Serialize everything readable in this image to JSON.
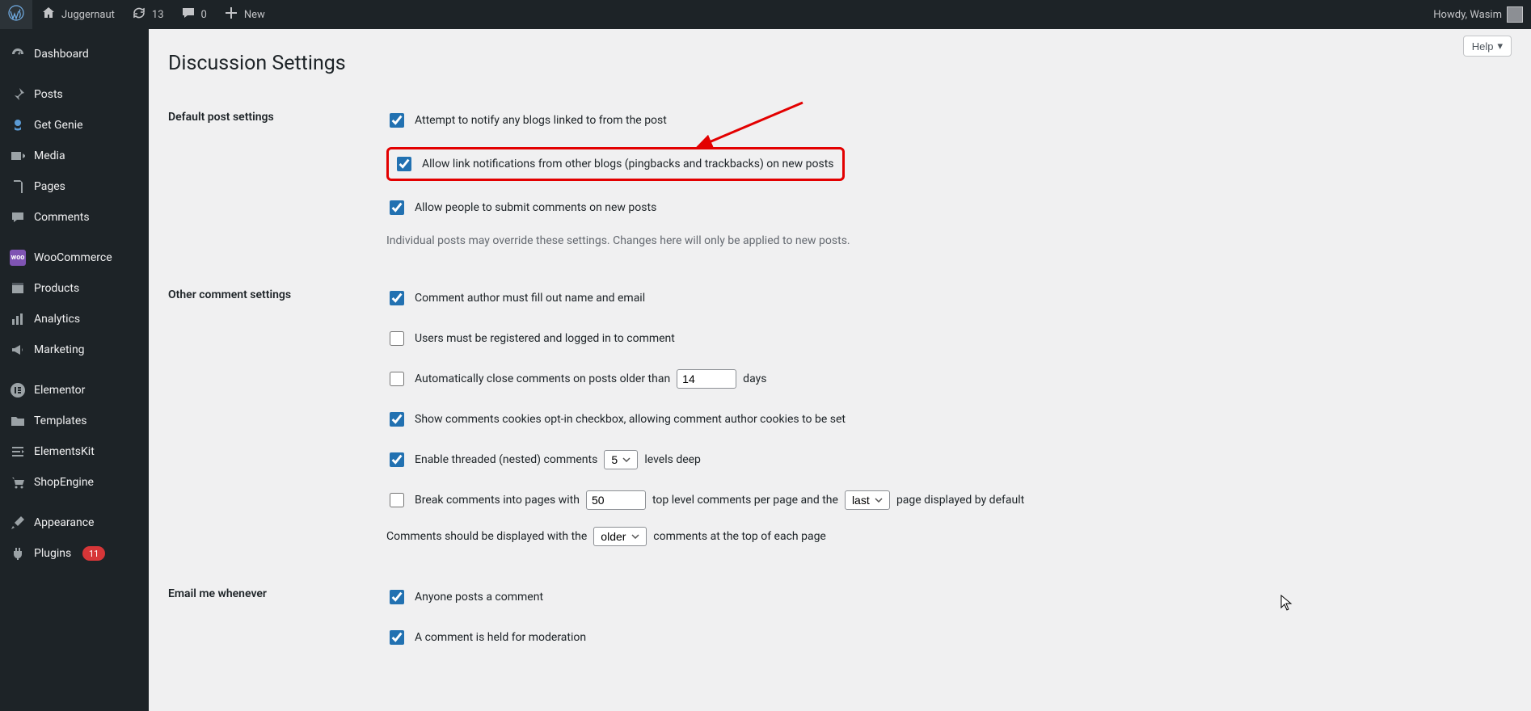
{
  "adminbar": {
    "site_name": "Juggernaut",
    "updates_count": "13",
    "comments_count": "0",
    "new_label": "New",
    "howdy": "Howdy, Wasim"
  },
  "menu": {
    "dashboard": "Dashboard",
    "posts": "Posts",
    "getgenie": "Get Genie",
    "media": "Media",
    "pages": "Pages",
    "comments": "Comments",
    "woocommerce": "WooCommerce",
    "products": "Products",
    "analytics": "Analytics",
    "marketing": "Marketing",
    "elementor": "Elementor",
    "templates": "Templates",
    "elementskit": "ElementsKit",
    "shopengine": "ShopEngine",
    "appearance": "Appearance",
    "plugins": "Plugins",
    "plugins_badge": "11"
  },
  "help_label": "Help",
  "page_title": "Discussion Settings",
  "rows": {
    "default_post": "Default post settings",
    "other_comment": "Other comment settings",
    "email_me": "Email me whenever"
  },
  "opts": {
    "pingback_out": "Attempt to notify any blogs linked to from the post",
    "pingback_in": "Allow link notifications from other blogs (pingbacks and trackbacks) on new posts",
    "allow_comments": "Allow people to submit comments on new posts",
    "override_note": "Individual posts may override these settings. Changes here will only be applied to new posts.",
    "author_fill": "Comment author must fill out name and email",
    "must_register": "Users must be registered and logged in to comment",
    "auto_close_a": "Automatically close comments on posts older than",
    "auto_close_b": "days",
    "cookies_opt": "Show comments cookies opt-in checkbox, allowing comment author cookies to be set",
    "threaded_a": "Enable threaded (nested) comments",
    "threaded_b": "levels deep",
    "paginate_a": "Break comments into pages with",
    "paginate_b": "top level comments per page and the",
    "paginate_c": "page displayed by default",
    "order_a": "Comments should be displayed with the",
    "order_b": "comments at the top of each page",
    "anyone_posts": "Anyone posts a comment",
    "held_moderation": "A comment is held for moderation"
  },
  "values": {
    "close_days": "14",
    "thread_depth": "5",
    "per_page": "50",
    "default_page": "last",
    "order": "older"
  }
}
